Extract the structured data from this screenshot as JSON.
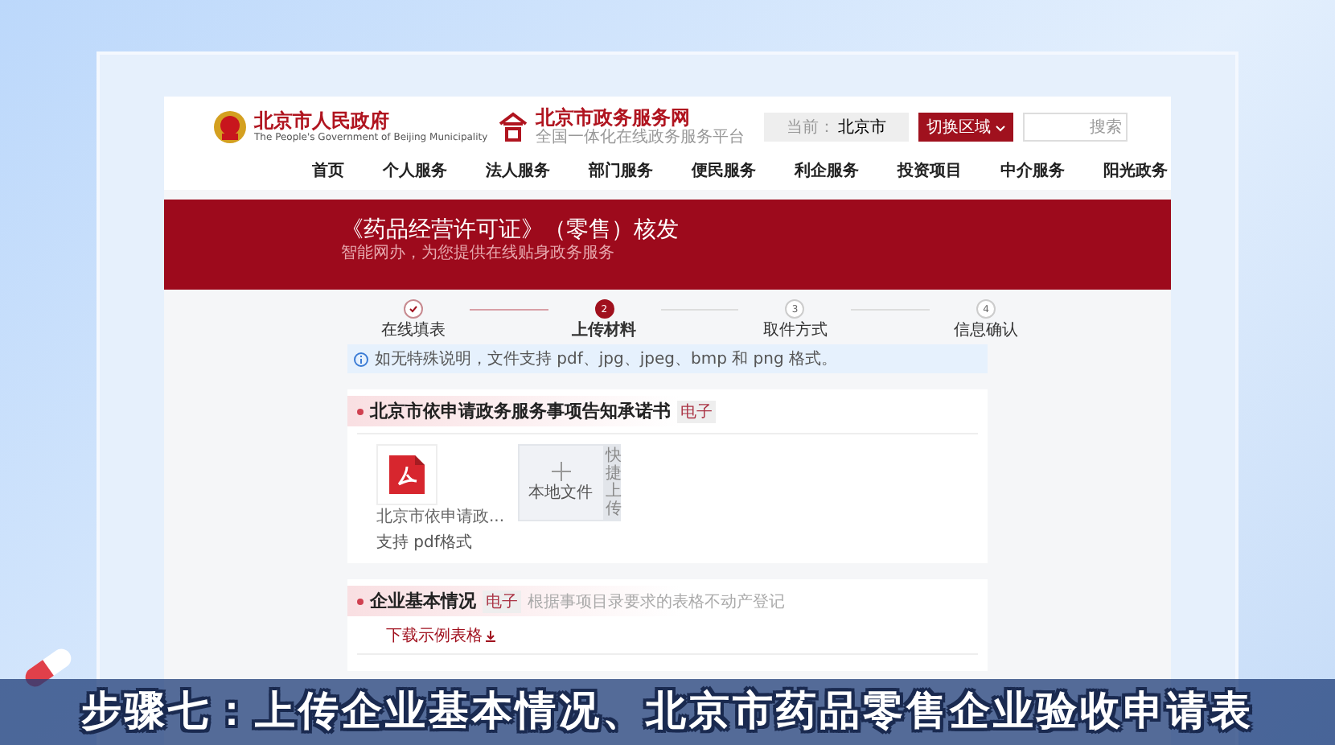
{
  "header": {
    "gov_logo": {
      "title": "北京市人民政府",
      "subtitle": "The People's Government of Beijing Municipality"
    },
    "portal_logo": {
      "title": "北京市政务服务网",
      "subtitle": "全国一体化在线政务服务平台"
    },
    "location": {
      "label": "当前：",
      "value": "北京市"
    },
    "region_button": "切换区域",
    "search": {
      "button": "搜索"
    }
  },
  "nav": [
    {
      "label": "首页"
    },
    {
      "label": "个人服务"
    },
    {
      "label": "法人服务"
    },
    {
      "label": "部门服务"
    },
    {
      "label": "便民服务"
    },
    {
      "label": "利企服务"
    },
    {
      "label": "投资项目"
    },
    {
      "label": "中介服务"
    },
    {
      "label": "阳光政务"
    }
  ],
  "banner": {
    "title": "《药品经营许可证》（零售）核发",
    "subtitle": "智能网办，为您提供在线贴身政务服务"
  },
  "steps": [
    {
      "label": "在线填表",
      "completed": true,
      "selected": false
    },
    {
      "number": "2",
      "label": "上传材料",
      "completed": false,
      "selected": true
    },
    {
      "number": "3",
      "label": "取件方式",
      "completed": false,
      "selected": false
    },
    {
      "number": "4",
      "label": "信息确认",
      "completed": false,
      "selected": false
    }
  ],
  "notice": "如无特殊说明，文件支持 pdf、jpg、jpeg、bmp 和 png 格式。",
  "sections": [
    {
      "title": "北京市依申请政务服务事项告知承诺书",
      "tag": "电子",
      "files": [
        {
          "name": "北京市依申请政..."
        }
      ],
      "upload": {
        "label": "本地文件",
        "quick": "快捷上传"
      },
      "hint": "支持 pdf格式"
    },
    {
      "title": "企业基本情况",
      "tag": "电子",
      "note": "根据事项目录要求的表格不动产登记",
      "link": "下载示例表格"
    }
  ],
  "caption": "步骤七：上传企业基本情况、北京市药品零售企业验收申请表"
}
